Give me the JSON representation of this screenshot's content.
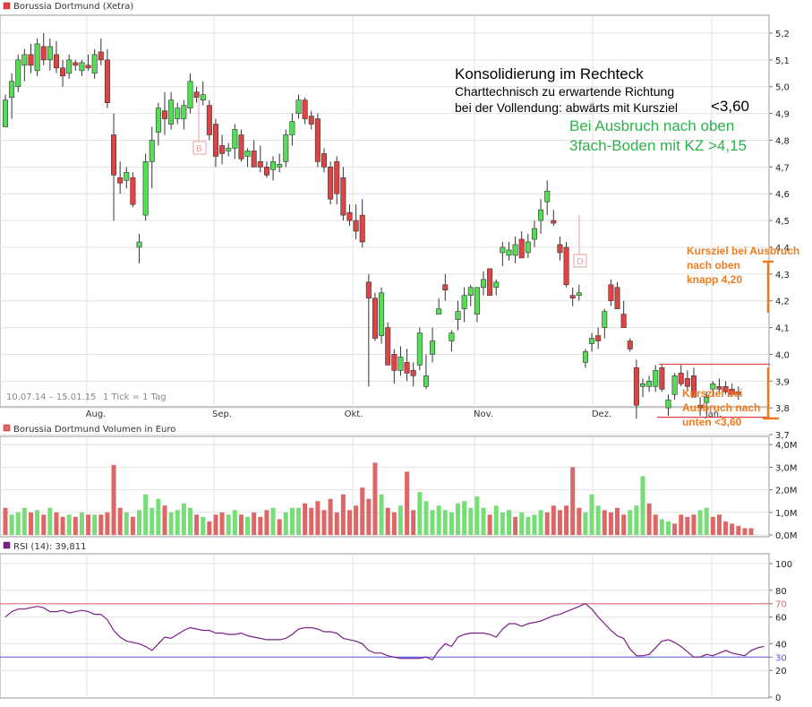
{
  "colors": {
    "up": "#55dd55",
    "down": "#dd4444",
    "vol_up": "#77dd77",
    "vol_down": "#dd6666",
    "rsi_line": "#7a1f8a",
    "orange": "#f07c1e",
    "green_text": "#2db34a",
    "level70": "#dd6666",
    "level30": "#5555dd"
  },
  "legends": {
    "price": "Borussia Dortmund (Xetra)",
    "volume": "Borussia Dortmund Volumen in Euro",
    "rsi": "RSI (14): 39,811"
  },
  "footer": {
    "range": "10.07.14 – 15.01.15",
    "tick": "1 Tick = 1 Tag"
  },
  "annotations": {
    "title": "Konsolidierung im Rechteck",
    "line1": "Charttechnisch zu erwartende Richtung",
    "line2": "bei der Vollendung: abwärts mit Kursziel",
    "target_low": "<3,60",
    "green1": "Bei Ausbruch nach oben",
    "green2": "3fach-Boden mit KZ >4,15",
    "up_target": [
      "Kursziel bei Ausbruch",
      "nach oben",
      "knapp 4,20"
    ],
    "down_target": [
      "Kursziel bei",
      "Ausbruch nach",
      "unten <3,60"
    ],
    "marker_b": "B",
    "marker_d": "D"
  },
  "chart_data": [
    {
      "type": "candlestick",
      "title": "Borussia Dortmund (Xetra)",
      "months": [
        "Aug.",
        "Sep.",
        "Okt.",
        "Nov.",
        "Dez.",
        "Jan."
      ],
      "y_ticks": [
        "5,2",
        "5,1",
        "5,0",
        "4,9",
        "4,8",
        "4,7",
        "4,6",
        "4,5",
        "4,4",
        "4,3",
        "4,2",
        "4,1",
        "4,0",
        "3,9",
        "3,8",
        "3,7"
      ],
      "ylim": [
        3.6,
        5.25
      ],
      "rectangle": {
        "top": 3.963,
        "bottom": 3.765
      },
      "ohlc": [
        [
          4.85,
          4.97,
          4.85,
          4.95
        ],
        [
          4.96,
          5.05,
          4.88,
          5.02
        ],
        [
          5.0,
          5.12,
          4.98,
          5.1
        ],
        [
          5.08,
          5.14,
          5.02,
          5.12
        ],
        [
          5.12,
          5.16,
          5.05,
          5.08
        ],
        [
          5.06,
          5.18,
          5.04,
          5.16
        ],
        [
          5.15,
          5.2,
          5.08,
          5.1
        ],
        [
          5.1,
          5.18,
          5.06,
          5.15
        ],
        [
          5.12,
          5.17,
          5.05,
          5.07
        ],
        [
          5.07,
          5.1,
          5.0,
          5.04
        ],
        [
          5.05,
          5.12,
          5.03,
          5.1
        ],
        [
          5.09,
          5.1,
          5.06,
          5.08
        ],
        [
          5.06,
          5.1,
          5.04,
          5.09
        ],
        [
          5.08,
          5.12,
          5.06,
          5.07
        ],
        [
          5.05,
          5.14,
          5.03,
          5.12
        ],
        [
          5.13,
          5.18,
          5.08,
          5.1
        ],
        [
          5.1,
          5.14,
          4.92,
          4.94
        ],
        [
          4.82,
          4.9,
          4.5,
          4.67
        ],
        [
          4.66,
          4.72,
          4.6,
          4.64
        ],
        [
          4.65,
          4.7,
          4.62,
          4.68
        ],
        [
          4.66,
          4.68,
          4.55,
          4.56
        ],
        [
          4.4,
          4.45,
          4.34,
          4.42
        ],
        [
          4.52,
          4.75,
          4.5,
          4.72
        ],
        [
          4.72,
          4.85,
          4.62,
          4.8
        ],
        [
          4.83,
          4.94,
          4.78,
          4.92
        ],
        [
          4.91,
          4.98,
          4.82,
          4.88
        ],
        [
          4.86,
          4.98,
          4.84,
          4.95
        ],
        [
          4.88,
          4.94,
          4.86,
          4.92
        ],
        [
          4.88,
          4.95,
          4.84,
          4.93
        ],
        [
          4.92,
          5.05,
          4.9,
          5.02
        ],
        [
          4.98,
          5.0,
          4.94,
          4.96
        ],
        [
          4.95,
          5.02,
          4.93,
          4.97
        ],
        [
          4.93,
          4.95,
          4.8,
          4.82
        ],
        [
          4.86,
          4.88,
          4.7,
          4.74
        ],
        [
          4.78,
          4.82,
          4.71,
          4.75
        ],
        [
          4.76,
          4.79,
          4.74,
          4.77
        ],
        [
          4.77,
          4.86,
          4.73,
          4.84
        ],
        [
          4.82,
          4.84,
          4.72,
          4.73
        ],
        [
          4.74,
          4.77,
          4.7,
          4.76
        ],
        [
          4.76,
          4.8,
          4.74,
          4.7
        ],
        [
          4.72,
          4.78,
          4.68,
          4.7
        ],
        [
          4.7,
          4.72,
          4.66,
          4.67
        ],
        [
          4.69,
          4.74,
          4.65,
          4.72
        ],
        [
          4.7,
          4.75,
          4.68,
          4.71
        ],
        [
          4.72,
          4.84,
          4.7,
          4.82
        ],
        [
          4.82,
          4.9,
          4.78,
          4.87
        ],
        [
          4.9,
          4.97,
          4.88,
          4.95
        ],
        [
          4.95,
          4.96,
          4.86,
          4.88
        ],
        [
          4.89,
          4.91,
          4.84,
          4.86
        ],
        [
          4.88,
          4.9,
          4.7,
          4.72
        ],
        [
          4.75,
          4.77,
          4.68,
          4.7
        ],
        [
          4.7,
          4.72,
          4.56,
          4.58
        ],
        [
          4.72,
          4.74,
          4.56,
          4.6
        ],
        [
          4.66,
          4.7,
          4.5,
          4.52
        ],
        [
          4.53,
          4.56,
          4.48,
          4.5
        ],
        [
          4.5,
          4.56,
          4.43,
          4.46
        ],
        [
          4.52,
          4.58,
          4.4,
          4.42
        ],
        [
          4.27,
          4.3,
          3.88,
          4.21
        ],
        [
          4.21,
          4.23,
          4.05,
          4.06
        ],
        [
          4.07,
          4.25,
          4.04,
          4.23
        ],
        [
          4.1,
          4.12,
          3.98,
          3.96
        ],
        [
          4.0,
          4.02,
          3.89,
          3.94
        ],
        [
          3.94,
          4.03,
          3.92,
          3.99
        ],
        [
          3.97,
          4.02,
          3.9,
          3.93
        ],
        [
          3.94,
          3.97,
          3.88,
          3.92
        ],
        [
          3.96,
          4.1,
          3.94,
          4.08
        ],
        [
          3.88,
          4.0,
          3.87,
          3.92
        ],
        [
          4.0,
          4.1,
          3.97,
          4.05
        ],
        [
          4.15,
          4.21,
          4.15,
          4.17
        ],
        [
          4.26,
          4.3,
          4.2,
          4.24
        ],
        [
          4.05,
          4.09,
          4.01,
          4.08
        ],
        [
          4.13,
          4.2,
          4.09,
          4.16
        ],
        [
          4.17,
          4.25,
          4.12,
          4.22
        ],
        [
          4.22,
          4.26,
          4.18,
          4.25
        ],
        [
          4.15,
          4.25,
          4.12,
          4.25
        ],
        [
          4.25,
          4.31,
          4.22,
          4.28
        ],
        [
          4.32,
          4.32,
          4.25,
          4.22
        ],
        [
          4.25,
          4.28,
          4.22,
          4.27
        ],
        [
          4.38,
          4.42,
          4.33,
          4.4
        ],
        [
          4.37,
          4.42,
          4.35,
          4.39
        ],
        [
          4.37,
          4.44,
          4.34,
          4.41
        ],
        [
          4.43,
          4.46,
          4.37,
          4.36
        ],
        [
          4.38,
          4.45,
          4.36,
          4.42
        ],
        [
          4.43,
          4.5,
          4.4,
          4.47
        ],
        [
          4.5,
          4.58,
          4.45,
          4.54
        ],
        [
          4.57,
          4.65,
          4.52,
          4.61
        ],
        [
          4.5,
          4.54,
          4.48,
          4.49
        ],
        [
          4.41,
          4.44,
          4.35,
          4.38
        ],
        [
          4.4,
          4.42,
          4.25,
          4.26
        ],
        [
          4.22,
          4.25,
          4.18,
          4.21
        ],
        [
          4.22,
          4.26,
          4.2,
          4.23
        ],
        [
          3.97,
          4.02,
          3.95,
          4.01
        ],
        [
          4.04,
          4.08,
          4.01,
          4.06
        ],
        [
          4.07,
          4.1,
          4.02,
          4.05
        ],
        [
          4.1,
          4.17,
          4.06,
          4.16
        ],
        [
          4.26,
          4.28,
          4.18,
          4.2
        ],
        [
          4.25,
          4.27,
          4.18,
          4.17
        ],
        [
          4.15,
          4.2,
          4.1,
          4.1
        ],
        [
          4.05,
          4.06,
          4.01,
          4.02
        ],
        [
          3.95,
          3.98,
          3.76,
          3.81
        ],
        [
          3.88,
          3.91,
          3.84,
          3.89
        ],
        [
          3.88,
          3.92,
          3.86,
          3.9
        ],
        [
          3.88,
          3.96,
          3.86,
          3.94
        ],
        [
          3.95,
          3.96,
          3.86,
          3.87
        ],
        [
          3.8,
          3.85,
          3.77,
          3.83
        ],
        [
          3.85,
          3.93,
          3.83,
          3.92
        ],
        [
          3.93,
          3.96,
          3.88,
          3.89
        ],
        [
          3.91,
          3.94,
          3.86,
          3.88
        ],
        [
          3.92,
          3.95,
          3.88,
          3.84
        ],
        [
          3.81,
          3.84,
          3.77,
          3.8
        ],
        [
          3.82,
          3.86,
          3.78,
          3.84
        ],
        [
          3.87,
          3.9,
          3.84,
          3.89
        ],
        [
          3.88,
          3.91,
          3.85,
          3.87
        ],
        [
          3.88,
          3.9,
          3.85,
          3.86
        ],
        [
          3.87,
          3.89,
          3.84,
          3.85
        ],
        [
          3.86,
          3.88,
          3.83,
          3.85
        ]
      ]
    },
    {
      "type": "bar",
      "title": "Borussia Dortmund Volumen in Euro",
      "y_ticks": [
        "4,0M",
        "3,0M",
        "2,0M",
        "1,0M",
        "0,0M"
      ],
      "ylim": [
        0,
        4.0
      ],
      "values_m": [
        1.2,
        0.9,
        1.0,
        1.2,
        1.0,
        1.1,
        0.9,
        1.2,
        1.0,
        0.8,
        0.9,
        0.8,
        1.0,
        0.9,
        0.9,
        0.9,
        1.0,
        3.1,
        1.2,
        1.0,
        0.8,
        1.1,
        1.8,
        1.2,
        1.6,
        1.3,
        1.0,
        1.1,
        1.4,
        1.2,
        0.9,
        0.8,
        0.6,
        0.9,
        1.0,
        0.9,
        1.1,
        0.9,
        0.8,
        1.0,
        0.8,
        1.1,
        1.2,
        0.7,
        1.0,
        1.2,
        1.2,
        1.4,
        1.2,
        1.5,
        1.1,
        1.6,
        1.0,
        1.8,
        1.1,
        1.3,
        2.1,
        1.6,
        3.2,
        1.8,
        1.2,
        1.0,
        1.3,
        2.8,
        1.1,
        1.9,
        1.5,
        1.1,
        1.3,
        1.1,
        1.0,
        1.4,
        1.5,
        1.2,
        1.7,
        1.2,
        0.9,
        1.3,
        1.0,
        1.1,
        0.8,
        1.0,
        0.8,
        0.9,
        1.1,
        1.0,
        1.3,
        1.1,
        1.3,
        3.0,
        1.2,
        1.0,
        1.8,
        1.3,
        1.1,
        1.0,
        1.2,
        0.9,
        1.1,
        1.3,
        2.6,
        1.4,
        0.9,
        0.7,
        0.6,
        0.5,
        0.9,
        0.8,
        0.9,
        1.1,
        1.2,
        0.8,
        0.9,
        0.6,
        0.5,
        0.4,
        0.3,
        0.3
      ],
      "up_flags": [
        0,
        1,
        1,
        1,
        0,
        1,
        0,
        1,
        0,
        0,
        1,
        0,
        1,
        0,
        1,
        0,
        0,
        0,
        0,
        1,
        0,
        1,
        1,
        1,
        1,
        0,
        1,
        1,
        1,
        1,
        0,
        1,
        0,
        0,
        0,
        1,
        1,
        0,
        1,
        0,
        0,
        0,
        1,
        0,
        1,
        1,
        1,
        0,
        0,
        0,
        0,
        0,
        0,
        0,
        0,
        0,
        0,
        0,
        0,
        1,
        0,
        0,
        1,
        0,
        0,
        1,
        1,
        1,
        1,
        1,
        1,
        1,
        1,
        1,
        1,
        1,
        0,
        1,
        1,
        1,
        0,
        1,
        1,
        1,
        1,
        0,
        0,
        0,
        0,
        0,
        0,
        1,
        1,
        1,
        0,
        0,
        0,
        0,
        1,
        1,
        1,
        0,
        0,
        1,
        1,
        0,
        0,
        0,
        0,
        1,
        1,
        0,
        0,
        0,
        0,
        0,
        0,
        0
      ]
    },
    {
      "type": "line",
      "title": "RSI (14)",
      "y_ticks": [
        "100",
        "80",
        "70",
        "60",
        "40",
        "30",
        "20",
        "0"
      ],
      "ylim": [
        0,
        100
      ],
      "levels": [
        70,
        30
      ],
      "values": [
        60,
        64,
        66,
        66,
        67,
        68,
        67,
        64,
        64,
        65,
        63,
        64,
        65,
        64,
        62,
        62,
        58,
        50,
        45,
        42,
        41,
        40,
        38,
        35,
        40,
        45,
        44,
        47,
        50,
        52,
        51,
        50,
        50,
        48,
        48,
        47,
        47,
        48,
        46,
        45,
        44,
        43,
        43,
        43,
        44,
        47,
        51,
        52,
        52,
        51,
        49,
        49,
        48,
        44,
        43,
        42,
        40,
        35,
        33,
        33,
        31,
        30,
        29,
        29,
        29,
        29,
        30,
        28,
        35,
        40,
        38,
        45,
        47,
        48,
        48,
        48,
        47,
        45,
        51,
        55,
        55,
        53,
        55,
        56,
        57,
        59,
        61,
        62,
        64,
        66,
        68,
        70,
        66,
        60,
        55,
        50,
        46,
        44,
        36,
        31,
        31,
        32,
        37,
        42,
        43,
        41,
        38,
        34,
        30,
        30,
        32,
        31,
        33,
        35,
        33,
        32,
        31,
        35,
        37,
        38
      ]
    }
  ]
}
